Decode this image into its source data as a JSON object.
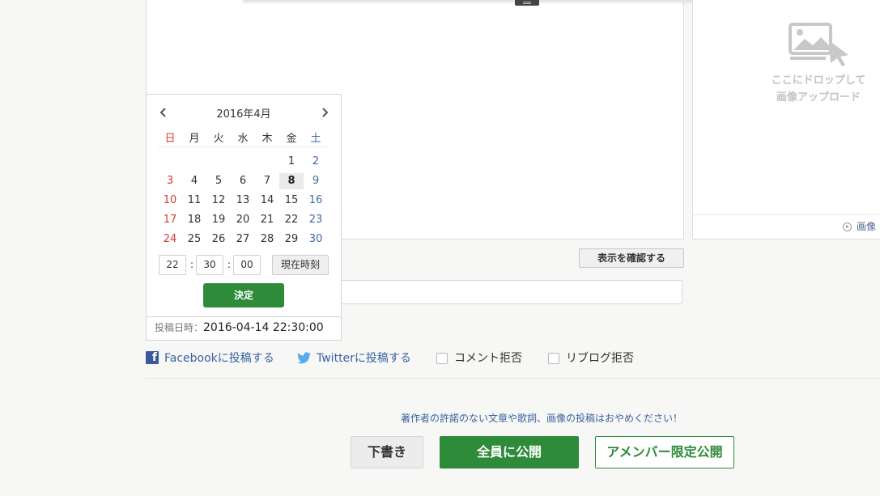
{
  "editor": {},
  "side_panel": {
    "drop_text_line1": "ここにドロップして",
    "drop_text_line2": "画像アップロード",
    "link_label": "画像"
  },
  "confirm_button": "表示を確認する",
  "calendar": {
    "title": "2016年4月",
    "weekdays": [
      "日",
      "月",
      "火",
      "水",
      "木",
      "金",
      "土"
    ],
    "weeks": [
      [
        "",
        "",
        "",
        "",
        "",
        "1",
        "2"
      ],
      [
        "3",
        "4",
        "5",
        "6",
        "7",
        "8",
        "9"
      ],
      [
        "10",
        "11",
        "12",
        "13",
        "14",
        "15",
        "16"
      ],
      [
        "17",
        "18",
        "19",
        "20",
        "21",
        "22",
        "23"
      ],
      [
        "24",
        "25",
        "26",
        "27",
        "28",
        "29",
        "30"
      ]
    ],
    "highlighted_day": "8",
    "hour": "22",
    "minute": "30",
    "second": "00",
    "colon": ":",
    "now_button": "現在時刻",
    "decide_button": "決定"
  },
  "post_date": {
    "label": "投稿日時：",
    "value": "2016-04-14 22:30:00"
  },
  "share": {
    "facebook": "Facebookに投稿する",
    "twitter": "Twitterに投稿する",
    "no_comments": "コメント拒否",
    "no_reblog": "リブログ拒否"
  },
  "notice": "著作者の許諾のない文章や歌詞、画像の投稿はおやめください！",
  "actions": {
    "draft": "下書き",
    "publish_all": "全員に公開",
    "publish_members": "アメンバー限定公開"
  },
  "colors": {
    "accent_green": "#2e8b3a",
    "link_blue": "#3a62a0",
    "sunday_red": "#d83a3a",
    "saturday_blue": "#3e6aa7"
  }
}
